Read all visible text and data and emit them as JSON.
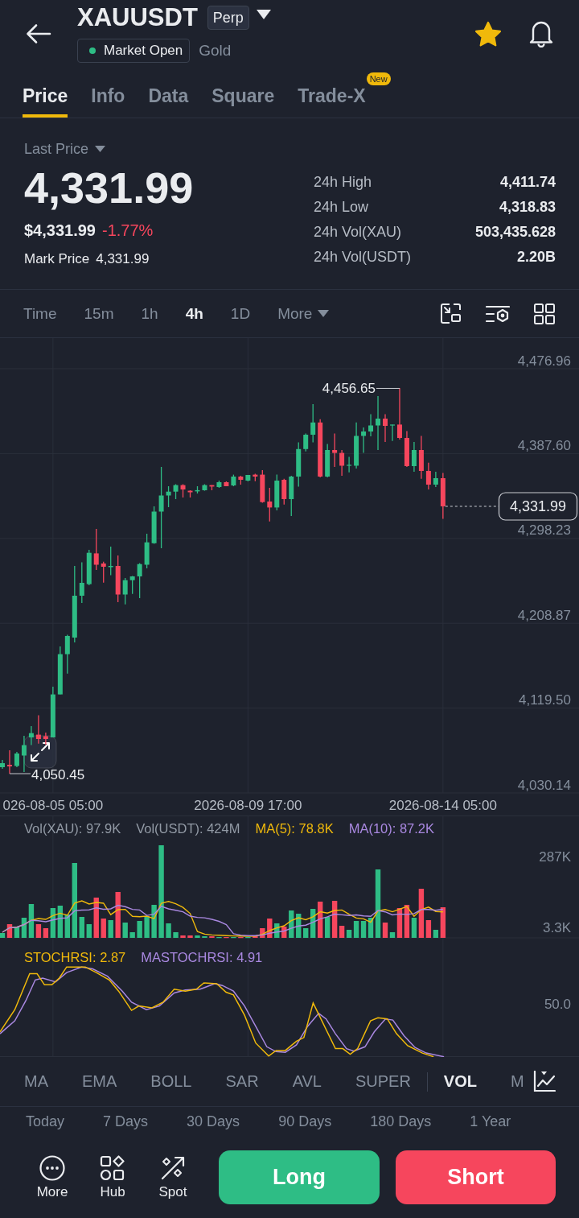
{
  "header": {
    "symbol": "XAUUSDT",
    "contract_type": "Perp",
    "market_status": "Market Open",
    "asset_name": "Gold",
    "favorite": true
  },
  "tabs": [
    {
      "label": "Price",
      "selected": true
    },
    {
      "label": "Info",
      "selected": false
    },
    {
      "label": "Data",
      "selected": false
    },
    {
      "label": "Square",
      "selected": false
    },
    {
      "label": "Trade-X",
      "selected": false,
      "badge": "New"
    }
  ],
  "price_panel": {
    "price_type": "Last Price",
    "last_price": "4,331.99",
    "usd_price": "$4,331.99",
    "change": "-1.77%",
    "mark_price_label": "Mark Price",
    "mark_price": "4,331.99",
    "stats": [
      {
        "label": "24h High",
        "value": "4,411.74"
      },
      {
        "label": "24h Low",
        "value": "4,318.83"
      },
      {
        "label": "24h Vol(XAU)",
        "value": "503,435.628"
      },
      {
        "label": "24h Vol(USDT)",
        "value": "2.20B"
      }
    ]
  },
  "intervals": [
    {
      "label": "Time",
      "kind": "option",
      "selected": false
    },
    {
      "label": "15m",
      "kind": "option",
      "selected": false
    },
    {
      "label": "1h",
      "kind": "option",
      "selected": false
    },
    {
      "label": "4h",
      "kind": "option",
      "selected": true
    },
    {
      "label": "1D",
      "kind": "option",
      "selected": false
    },
    {
      "label": "More",
      "kind": "dropdown",
      "selected": false
    }
  ],
  "price_chart": {
    "chart_data": {
      "type": "candlestick",
      "x": [
        "2026-08-04 01:00",
        "2026-08-04 05:00",
        "2026-08-04 09:00",
        "2026-08-04 13:00",
        "2026-08-04 17:00",
        "2026-08-04 21:00",
        "2026-08-05 01:00",
        "2026-08-05 05:00",
        "2026-08-05 09:00",
        "2026-08-05 13:00",
        "2026-08-05 17:00",
        "2026-08-05 21:00",
        "2026-08-06 01:00",
        "2026-08-06 05:00",
        "2026-08-06 09:00",
        "2026-08-06 13:00",
        "2026-08-06 17:00",
        "2026-08-06 21:00",
        "2026-08-07 01:00",
        "2026-08-07 05:00",
        "2026-08-07 09:00",
        "2026-08-07 13:00",
        "2026-08-07 17:00",
        "2026-08-07 21:00",
        "2026-08-08 01:00",
        "2026-08-08 05:00",
        "2026-08-08 09:00",
        "2026-08-08 13:00",
        "2026-08-08 17:00",
        "2026-08-08 21:00",
        "2026-08-09 01:00",
        "2026-08-09 05:00",
        "2026-08-09 09:00",
        "2026-08-09 13:00",
        "2026-08-09 17:00",
        "2026-08-09 21:00",
        "2026-08-10 01:00",
        "2026-08-10 05:00",
        "2026-08-10 09:00",
        "2026-08-10 13:00",
        "2026-08-10 17:00",
        "2026-08-10 21:00",
        "2026-08-11 01:00",
        "2026-08-11 05:00",
        "2026-08-11 09:00",
        "2026-08-11 13:00",
        "2026-08-11 17:00",
        "2026-08-11 21:00",
        "2026-08-12 01:00",
        "2026-08-12 05:00",
        "2026-08-12 09:00",
        "2026-08-12 13:00",
        "2026-08-12 17:00",
        "2026-08-12 21:00",
        "2026-08-13 01:00",
        "2026-08-13 05:00",
        "2026-08-13 09:00",
        "2026-08-13 13:00",
        "2026-08-13 17:00",
        "2026-08-13 21:00",
        "2026-08-14 01:00",
        "2026-08-14 05:00"
      ],
      "ohlc": [
        [
          4057.27,
          4064.9,
          4055.58,
          4061.51
        ],
        [
          4059.82,
          4075.08,
          4050.45,
          4058.12
        ],
        [
          4058.54,
          4073.38,
          4057.27,
          4071.69
        ],
        [
          4069.56,
          4090.34,
          4052.19,
          4080.5
        ],
        [
          4088.64,
          4100.51,
          4080.59,
          4093.14
        ],
        [
          4091.53,
          4111.96,
          4082.11,
          4086.95
        ],
        [
          4089.91,
          4093.73,
          4081.01,
          4086.95
        ],
        [
          4088.64,
          4142.06,
          4088.64,
          4133.92
        ],
        [
          4133.92,
          4184.45,
          4133.92,
          4176.31
        ],
        [
          4176.31,
          4196.74,
          4155.88,
          4195.47
        ],
        [
          4193.78,
          4269.24,
          4188.69,
          4237.87
        ],
        [
          4237.87,
          4273.05,
          4230.24,
          4251.43
        ],
        [
          4250.07,
          4286.19,
          4248.89,
          4283.06
        ],
        [
          4282.46,
          4308.24,
          4265.0,
          4270.51
        ],
        [
          4271.78,
          4273.64,
          4251.69,
          4268.39
        ],
        [
          4267.96,
          4289.58,
          4259.57,
          4269.24
        ],
        [
          4269.24,
          4280.26,
          4231.08,
          4239.14
        ],
        [
          4239.14,
          4256.52,
          4228.79,
          4254.23
        ],
        [
          4254.23,
          4258.64,
          4239.73,
          4258.21
        ],
        [
          4258.21,
          4272.12,
          4235.32,
          4271.19
        ],
        [
          4270.51,
          4303.15,
          4266.69,
          4294.08
        ],
        [
          4293.15,
          4331.98,
          4292.55,
          4326.47
        ],
        [
          4326.47,
          4373.52,
          4287.89,
          4343.42
        ],
        [
          4343.42,
          4353.17,
          4331.13,
          4347.49
        ],
        [
          4347.49,
          4355.29,
          4339.61,
          4354.36
        ],
        [
          4354.36,
          4355.29,
          4341.3,
          4349.78
        ],
        [
          4348.43,
          4348.93,
          4341.3,
          4346.81
        ],
        [
          4347.75,
          4353.17,
          4345.54,
          4349.02
        ],
        [
          4348.93,
          4355.29,
          4348.43,
          4354.36
        ],
        [
          4354.36,
          4354.36,
          4348.93,
          4352.83
        ],
        [
          4352.33,
          4359.11,
          4351.48,
          4357.41
        ],
        [
          4357.41,
          4358.26,
          4353.17,
          4353.17
        ],
        [
          4354.02,
          4365.38,
          4353.17,
          4363.35
        ],
        [
          4363.35,
          4364.19,
          4354.87,
          4359.96
        ],
        [
          4359.11,
          4365.04,
          4358.26,
          4365.04
        ],
        [
          4365.38,
          4366.32,
          4358.43,
          4363.35
        ],
        [
          4365.38,
          4370.13,
          4335.88,
          4336.47
        ],
        [
          4337.06,
          4351.48,
          4316.04,
          4330.79
        ],
        [
          4330.79,
          4365.38,
          4327.74,
          4359.11
        ],
        [
          4359.96,
          4360.97,
          4333.93,
          4339.61
        ],
        [
          4339.61,
          4364.19,
          4321.8,
          4363.35
        ],
        [
          4363.35,
          4399.3,
          4352.83,
          4392.34
        ],
        [
          4392.34,
          4408.71,
          4389.89,
          4407.44
        ],
        [
          4407.44,
          4439.65,
          4399.3,
          4420.32
        ],
        [
          4420.32,
          4423.8,
          4362.5,
          4363.35
        ],
        [
          4363.35,
          4397.69,
          4362.5,
          4391.33
        ],
        [
          4391.33,
          4408.71,
          4373.52,
          4388.27
        ],
        [
          4388.27,
          4391.33,
          4364.19,
          4374.79
        ],
        [
          4374.79,
          4384.21,
          4367.84,
          4375.73
        ],
        [
          4374.79,
          4420.32,
          4371.83,
          4406.16
        ],
        [
          4406.16,
          4415.07,
          4388.27,
          4410.83
        ],
        [
          4410.83,
          4429.14,
          4405.74,
          4417.19
        ],
        [
          4417.19,
          4448.13,
          4391.33,
          4424.39
        ],
        [
          4424.39,
          4429.14,
          4399.81,
          4416.76
        ],
        [
          4417.19,
          4418.12,
          4400.82,
          4418.12
        ],
        [
          4418.12,
          4456.65,
          4402.35,
          4404.04
        ],
        [
          4404.04,
          4411.25,
          4373.52,
          4374.37
        ],
        [
          4374.37,
          4399.81,
          4368.43,
          4391.33
        ],
        [
          4391.33,
          4406.16,
          4360.97,
          4369.28
        ],
        [
          4369.28,
          4377.93,
          4349.78,
          4354.87
        ],
        [
          4354.87,
          4368.43,
          4352.33,
          4361.65
        ],
        [
          4361.65,
          4367.25,
          4318.83,
          4331.99
        ]
      ],
      "xlim": [
        "2026-08-03 23:40",
        "2026-08-17 08:20"
      ],
      "ylim": [
        4030.14,
        4476.96
      ],
      "yticks": [
        {
          "value": 4476.96,
          "label": "4,476.96"
        },
        {
          "value": 4387.6,
          "label": "4,387.60"
        },
        {
          "value": 4298.23,
          "label": "4,298.23"
        },
        {
          "value": 4208.87,
          "label": "4,208.87"
        },
        {
          "value": 4119.5,
          "label": "4,119.50"
        },
        {
          "value": 4030.14,
          "label": "4,030.14"
        }
      ],
      "xticks": [
        {
          "value": "2026-08-05 05:00",
          "label": "026-08-05 05:00"
        },
        {
          "value": "2026-08-09 17:00",
          "label": "2026-08-09 17:00"
        },
        {
          "value": "2026-08-14 05:00",
          "label": "2026-08-14 05:00"
        }
      ],
      "grid": true,
      "annotations": [
        {
          "text": "4,456.65",
          "x": "2026-08-13 05:00",
          "y": 4456.65
        },
        {
          "text": "4,331.99",
          "x": "2026-08-14 05:00",
          "y": 4331.99
        },
        {
          "text": "4,050.45",
          "x": "2026-08-04 05:00",
          "y": 4050.45
        }
      ]
    }
  },
  "volume_panel": {
    "legend": [
      {
        "text": "Vol(XAU): 97.9K",
        "color": "#929aa5"
      },
      {
        "text": "Vol(USDT): 424M",
        "color": "#929aa5"
      },
      {
        "text": "MA(5): 78.8K",
        "color": "#f0b90b"
      },
      {
        "text": "MA(10): 87.2K",
        "color": "#a988e0"
      }
    ],
    "axis": [
      "287K",
      "3.3K"
    ]
  },
  "stochrsi_panel": {
    "legend": [
      {
        "text": "STOCHRSI: 2.87",
        "color": "#f0b90b"
      },
      {
        "text": "MASTOCHRSI: 4.91",
        "color": "#a988e0"
      }
    ],
    "axis": [
      "50.0"
    ]
  },
  "main_indicators": [
    {
      "label": "MA",
      "selected": false
    },
    {
      "label": "EMA",
      "selected": false
    },
    {
      "label": "BOLL",
      "selected": false
    },
    {
      "label": "SAR",
      "selected": false
    },
    {
      "label": "AVL",
      "selected": false
    },
    {
      "label": "SUPER",
      "selected": false
    }
  ],
  "sub_indicators": [
    {
      "label": "VOL",
      "selected": true
    },
    {
      "label": "M",
      "selected": false
    }
  ],
  "ranges": [
    "Today",
    "7 Days",
    "30 Days",
    "90 Days",
    "180 Days",
    "1 Year"
  ],
  "bottom_bar": {
    "shortcuts": [
      "More",
      "Hub",
      "Spot"
    ],
    "long_button": "Long",
    "short_button": "Short"
  }
}
